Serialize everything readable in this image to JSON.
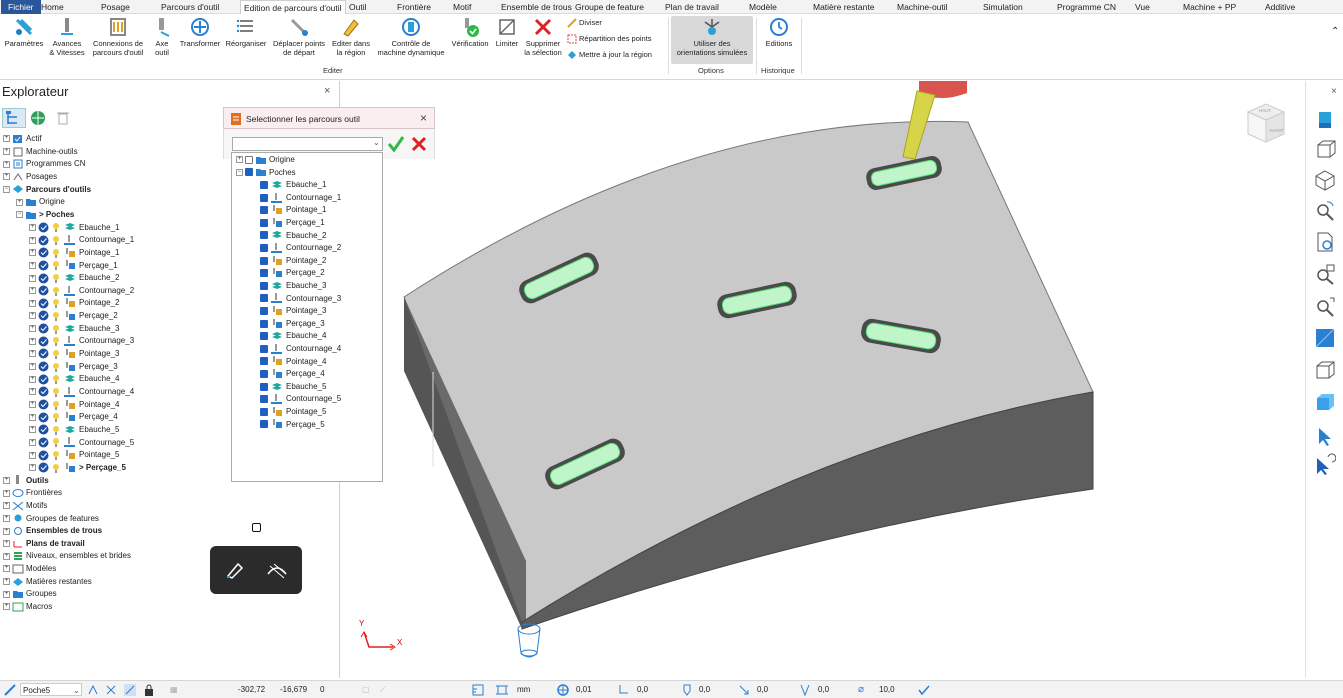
{
  "menubar": {
    "tabs": [
      "Fichier",
      "Home",
      "Posage",
      "Parcours d'outil",
      "Edition de parcours d'outil",
      "Outil",
      "Frontière",
      "Motif",
      "Ensemble de trous",
      "Groupe de feature",
      "Plan de travail",
      "Modèle",
      "Matière restante",
      "Machine-outil",
      "Simulation",
      "Programme CN",
      "Vue",
      "Machine + PP",
      "Additive"
    ],
    "active": "Edition de parcours d'outil"
  },
  "ribbon": {
    "params": "Paramètres",
    "feeds_1": "Avances",
    "feeds_2": "& Vitesses",
    "links_1": "Connexions de",
    "links_2": "parcours d'outil",
    "axis_1": "Axe",
    "axis_2": "outil",
    "transform": "Transformer",
    "reorder": "Réorganiser",
    "move_start_1": "Déplacer points",
    "move_start_2": "de départ",
    "edit_region_1": "Editer dans",
    "edit_region_2": "la région",
    "dyn_ctrl_1": "Contrôle de",
    "dyn_ctrl_2": "machine dynamique",
    "verify": "Vérification",
    "limit": "Limiter",
    "delete_sel_1": "Supprimer",
    "delete_sel_2": "la sélection",
    "divide": "Diviser",
    "distrib": "Répartition des points",
    "update_reg": "Mettre à jour la région",
    "group_edit": "Editer",
    "simulated_1": "Utiliser des",
    "simulated_2": "orientations simulées",
    "group_options": "Options",
    "editions": "Editions",
    "group_history": "Historique"
  },
  "explorer": {
    "title": "Explorateur",
    "items": [
      {
        "label": "Actif",
        "bold": false,
        "level": 0
      },
      {
        "label": "Machine-outils",
        "bold": false,
        "level": 0
      },
      {
        "label": "Programmes CN",
        "bold": false,
        "level": 0
      },
      {
        "label": "Posages",
        "bold": false,
        "level": 0
      },
      {
        "label": "Parcours d'outils",
        "bold": true,
        "level": 0
      },
      {
        "label": "Origine",
        "bold": false,
        "level": 1
      },
      {
        "label": "> Poches",
        "bold": true,
        "level": 1
      },
      {
        "label": "Ebauche_1",
        "bold": false,
        "level": 2,
        "kind": "eb"
      },
      {
        "label": "Contournage_1",
        "bold": false,
        "level": 2,
        "kind": "co"
      },
      {
        "label": "Pointage_1",
        "bold": false,
        "level": 2,
        "kind": "po"
      },
      {
        "label": "Perçage_1",
        "bold": false,
        "level": 2,
        "kind": "pe"
      },
      {
        "label": "Ebauche_2",
        "bold": false,
        "level": 2,
        "kind": "eb"
      },
      {
        "label": "Contournage_2",
        "bold": false,
        "level": 2,
        "kind": "co"
      },
      {
        "label": "Pointage_2",
        "bold": false,
        "level": 2,
        "kind": "po"
      },
      {
        "label": "Perçage_2",
        "bold": false,
        "level": 2,
        "kind": "pe"
      },
      {
        "label": "Ebauche_3",
        "bold": false,
        "level": 2,
        "kind": "eb"
      },
      {
        "label": "Contournage_3",
        "bold": false,
        "level": 2,
        "kind": "co"
      },
      {
        "label": "Pointage_3",
        "bold": false,
        "level": 2,
        "kind": "po"
      },
      {
        "label": "Perçage_3",
        "bold": false,
        "level": 2,
        "kind": "pe"
      },
      {
        "label": "Ebauche_4",
        "bold": false,
        "level": 2,
        "kind": "eb"
      },
      {
        "label": "Contournage_4",
        "bold": false,
        "level": 2,
        "kind": "co"
      },
      {
        "label": "Pointage_4",
        "bold": false,
        "level": 2,
        "kind": "po"
      },
      {
        "label": "Perçage_4",
        "bold": false,
        "level": 2,
        "kind": "pe"
      },
      {
        "label": "Ebauche_5",
        "bold": false,
        "level": 2,
        "kind": "eb"
      },
      {
        "label": "Contournage_5",
        "bold": false,
        "level": 2,
        "kind": "co"
      },
      {
        "label": "Pointage_5",
        "bold": false,
        "level": 2,
        "kind": "po"
      },
      {
        "label": "> Perçage_5",
        "bold": true,
        "level": 2,
        "kind": "pe"
      },
      {
        "label": "Outils",
        "bold": true,
        "level": 0
      },
      {
        "label": "Frontières",
        "bold": false,
        "level": 0
      },
      {
        "label": "Motifs",
        "bold": false,
        "level": 0
      },
      {
        "label": "Groupes de features",
        "bold": false,
        "level": 0
      },
      {
        "label": "Ensembles de trous",
        "bold": true,
        "level": 0
      },
      {
        "label": "Plans de travail",
        "bold": true,
        "level": 0
      },
      {
        "label": "Niveaux, ensembles et brides",
        "bold": false,
        "level": 0
      },
      {
        "label": "Modèles",
        "bold": false,
        "level": 0
      },
      {
        "label": "Matières restantes",
        "bold": false,
        "level": 0
      },
      {
        "label": "Groupes",
        "bold": false,
        "level": 0
      },
      {
        "label": "Macros",
        "bold": false,
        "level": 0
      }
    ]
  },
  "dialog": {
    "title": "Selectionner les parcours outil",
    "tree": [
      {
        "label": "Origine",
        "checked": false,
        "level": 0
      },
      {
        "label": "Poches",
        "checked": true,
        "level": 0
      },
      {
        "label": "Ebauche_1",
        "checked": true,
        "level": 1,
        "kind": "eb"
      },
      {
        "label": "Contournage_1",
        "checked": true,
        "level": 1,
        "kind": "co"
      },
      {
        "label": "Pointage_1",
        "checked": true,
        "level": 1,
        "kind": "po"
      },
      {
        "label": "Perçage_1",
        "checked": true,
        "level": 1,
        "kind": "pe"
      },
      {
        "label": "Ebauche_2",
        "checked": true,
        "level": 1,
        "kind": "eb"
      },
      {
        "label": "Contournage_2",
        "checked": true,
        "level": 1,
        "kind": "co"
      },
      {
        "label": "Pointage_2",
        "checked": true,
        "level": 1,
        "kind": "po"
      },
      {
        "label": "Perçage_2",
        "checked": true,
        "level": 1,
        "kind": "pe"
      },
      {
        "label": "Ebauche_3",
        "checked": true,
        "level": 1,
        "kind": "eb"
      },
      {
        "label": "Contournage_3",
        "checked": true,
        "level": 1,
        "kind": "co"
      },
      {
        "label": "Pointage_3",
        "checked": true,
        "level": 1,
        "kind": "po"
      },
      {
        "label": "Perçage_3",
        "checked": true,
        "level": 1,
        "kind": "pe"
      },
      {
        "label": "Ebauche_4",
        "checked": true,
        "level": 1,
        "kind": "eb"
      },
      {
        "label": "Contournage_4",
        "checked": true,
        "level": 1,
        "kind": "co"
      },
      {
        "label": "Pointage_4",
        "checked": true,
        "level": 1,
        "kind": "po"
      },
      {
        "label": "Perçage_4",
        "checked": true,
        "level": 1,
        "kind": "pe"
      },
      {
        "label": "Ebauche_5",
        "checked": true,
        "level": 1,
        "kind": "eb"
      },
      {
        "label": "Contournage_5",
        "checked": true,
        "level": 1,
        "kind": "co"
      },
      {
        "label": "Pointage_5",
        "checked": true,
        "level": 1,
        "kind": "po"
      },
      {
        "label": "Perçage_5",
        "checked": true,
        "level": 1,
        "kind": "pe"
      }
    ]
  },
  "viewcube": {
    "top": "HAUT",
    "front": "AVANT"
  },
  "axes": {
    "x": "X",
    "y": "Y"
  },
  "status": {
    "toolpath": "Poche5",
    "x": "-302,72",
    "y": "-16,679",
    "z": "0",
    "units": "mm",
    "tol": "0,01",
    "v1": "0,0",
    "v2": "0,0",
    "v3": "0,0",
    "v4": "0,0",
    "diam": "10,0"
  },
  "colors": {
    "accent": "#2b579a",
    "toolpath_green": "#55e07a",
    "tool_yellow": "#d8d44a",
    "tool_red": "#d9534f",
    "block_top": "#c8c8c8"
  }
}
